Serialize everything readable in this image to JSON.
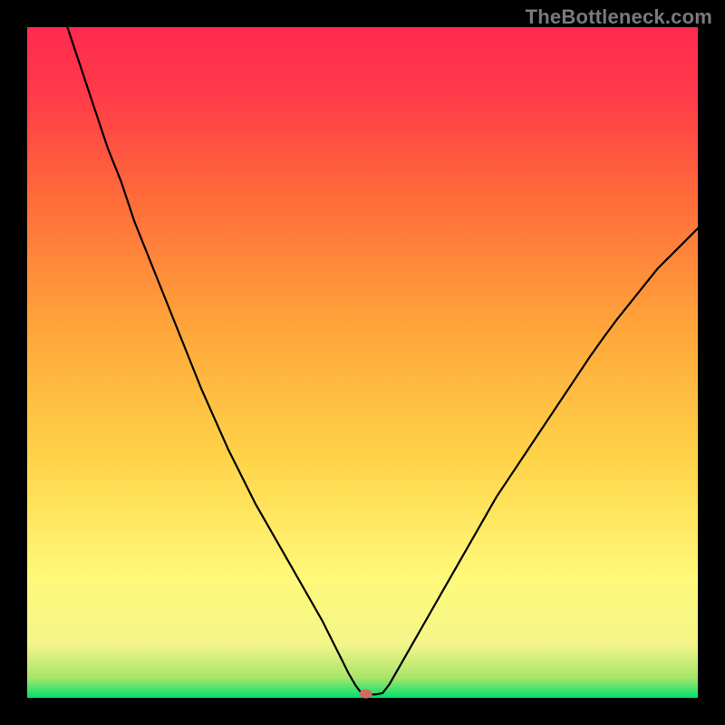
{
  "watermark": "TheBottleneck.com",
  "frame": {
    "outer_width": 800,
    "outer_height": 800,
    "border": 30,
    "bg": "#000000"
  },
  "chart_data": {
    "type": "line",
    "title": "",
    "xlabel": "",
    "ylabel": "",
    "xlim": [
      0,
      100
    ],
    "ylim": [
      0,
      100
    ],
    "gradient_stops": [
      {
        "t": 0.0,
        "color": "#00e06e"
      },
      {
        "t": 0.03,
        "color": "#a7e56a"
      },
      {
        "t": 0.08,
        "color": "#f4f58a"
      },
      {
        "t": 0.18,
        "color": "#fff97a"
      },
      {
        "t": 0.35,
        "color": "#ffd54a"
      },
      {
        "t": 0.55,
        "color": "#ffa63a"
      },
      {
        "t": 0.75,
        "color": "#ff6a3a"
      },
      {
        "t": 0.9,
        "color": "#ff3a49"
      },
      {
        "t": 1.0,
        "color": "#ff2a50"
      }
    ],
    "series": [
      {
        "name": "curve",
        "stroke": "#000000",
        "stroke_width": 2.2,
        "x": [
          6,
          8,
          10,
          12,
          14,
          16,
          18,
          20,
          22,
          24,
          26,
          28,
          30,
          32,
          34,
          36,
          38,
          40,
          42,
          44,
          45,
          46,
          47,
          48,
          49,
          50,
          51,
          52,
          53,
          54,
          56,
          58,
          60,
          62,
          64,
          66,
          68,
          70,
          72,
          74,
          76,
          78,
          80,
          82,
          84,
          86,
          88,
          90,
          92,
          94,
          96,
          98,
          100
        ],
        "y": [
          100,
          94,
          88,
          82,
          77,
          71,
          66,
          61,
          56,
          51,
          46,
          41.5,
          37,
          33,
          29,
          25.5,
          22,
          18.5,
          15,
          11.5,
          9.5,
          7.5,
          5.5,
          3.5,
          1.8,
          0.5,
          0.5,
          0.5,
          0.7,
          2,
          5.5,
          9,
          12.5,
          16,
          19.5,
          23,
          26.5,
          30,
          33,
          36,
          39,
          42,
          45,
          48,
          51,
          53.8,
          56.5,
          59,
          61.5,
          64,
          66,
          68,
          70
        ]
      }
    ],
    "marker": {
      "x": 50.5,
      "y": 0.6,
      "rx": 7,
      "ry": 5,
      "fill": "#cf6b62"
    }
  }
}
